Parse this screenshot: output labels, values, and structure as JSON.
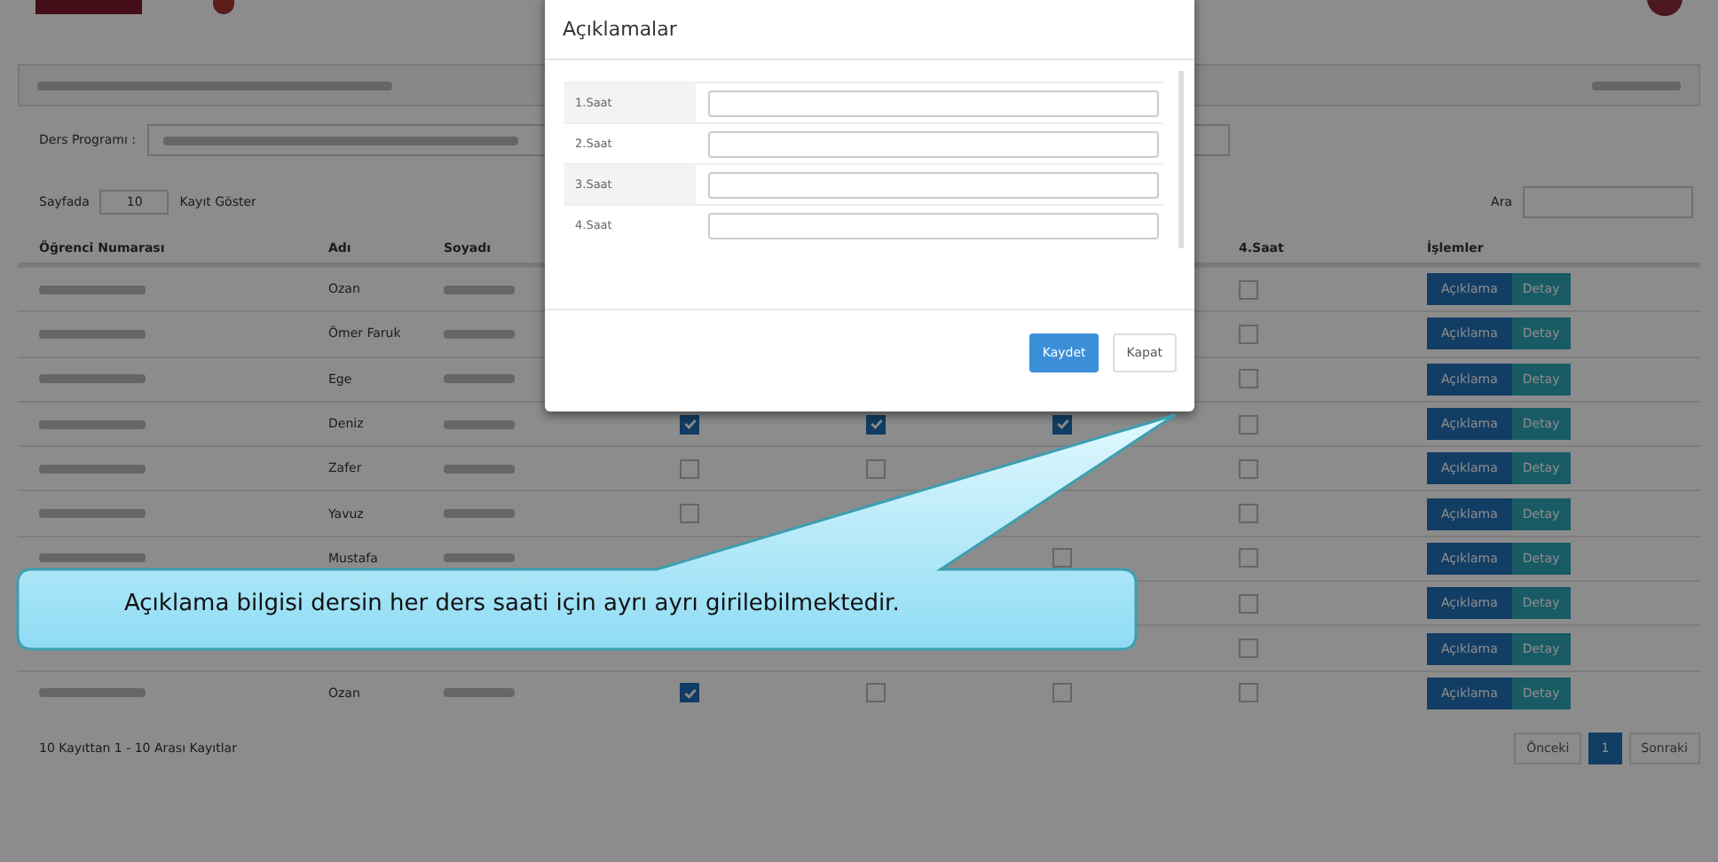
{
  "filters": {
    "program_label": "Ders Programı :",
    "page_size_label": "Sayfada",
    "page_size": "10",
    "page_size_suffix": "Kayıt Göster",
    "search_label": "Ara"
  },
  "table": {
    "columns": [
      "Öğrenci Numarası",
      "Adı",
      "Soyadı",
      "4.Saat",
      "İşlemler"
    ],
    "rows": [
      {
        "name": "Ozan",
        "saat_4": false,
        "buttons": [
          "Açıklama",
          "Detay"
        ]
      },
      {
        "name": "Ömer Faruk",
        "saat_4": false,
        "buttons": [
          "Açıklama",
          "Detay"
        ]
      },
      {
        "name": "Ege",
        "saat_4": false,
        "buttons": [
          "Açıklama",
          "Detay"
        ]
      },
      {
        "name": "Deniz",
        "saat_1": true,
        "saat_2": true,
        "saat_3": true,
        "saat_4": false,
        "buttons": [
          "Açıklama",
          "Detay"
        ]
      },
      {
        "name": "Zafer",
        "saat_1": false,
        "saat_2": false,
        "saat_4": false,
        "buttons": [
          "Açıklama",
          "Detay"
        ]
      },
      {
        "name": "Yavuz",
        "saat_1": false,
        "saat_4": false,
        "buttons": [
          "Açıklama",
          "Detay"
        ]
      },
      {
        "name": "Mustafa",
        "saat_3": false,
        "saat_4": false,
        "buttons": [
          "Açıklama",
          "Detay"
        ]
      },
      {
        "saat_4": false,
        "buttons": [
          "Açıklama",
          "Detay"
        ]
      },
      {
        "saat_4": false,
        "buttons": [
          "Açıklama",
          "Detay"
        ]
      },
      {
        "name": "Ozan",
        "saat_1": true,
        "saat_2": false,
        "saat_3": false,
        "saat_4": false,
        "buttons": [
          "Açıklama",
          "Detay"
        ]
      }
    ]
  },
  "footer": {
    "info": "10 Kayıttan 1 - 10 Arası Kayıtlar",
    "pages": [
      {
        "label": "Önceki",
        "selected": false
      },
      {
        "label": "1",
        "selected": true
      },
      {
        "label": "Sonraki",
        "selected": false
      }
    ]
  },
  "modal": {
    "title": "Açıklamalar",
    "fields": [
      {
        "label": "1.Saat"
      },
      {
        "label": "2.Saat"
      },
      {
        "label": "3.Saat"
      },
      {
        "label": "4.Saat"
      }
    ],
    "buttons": [
      {
        "label": "Kaydet",
        "kind": "primary"
      },
      {
        "label": "Kapat",
        "kind": "default"
      }
    ]
  },
  "callout": {
    "text": "Açıklama bilgisi dersin her ders saati için ayrı ayrı girilebilmektedir."
  }
}
